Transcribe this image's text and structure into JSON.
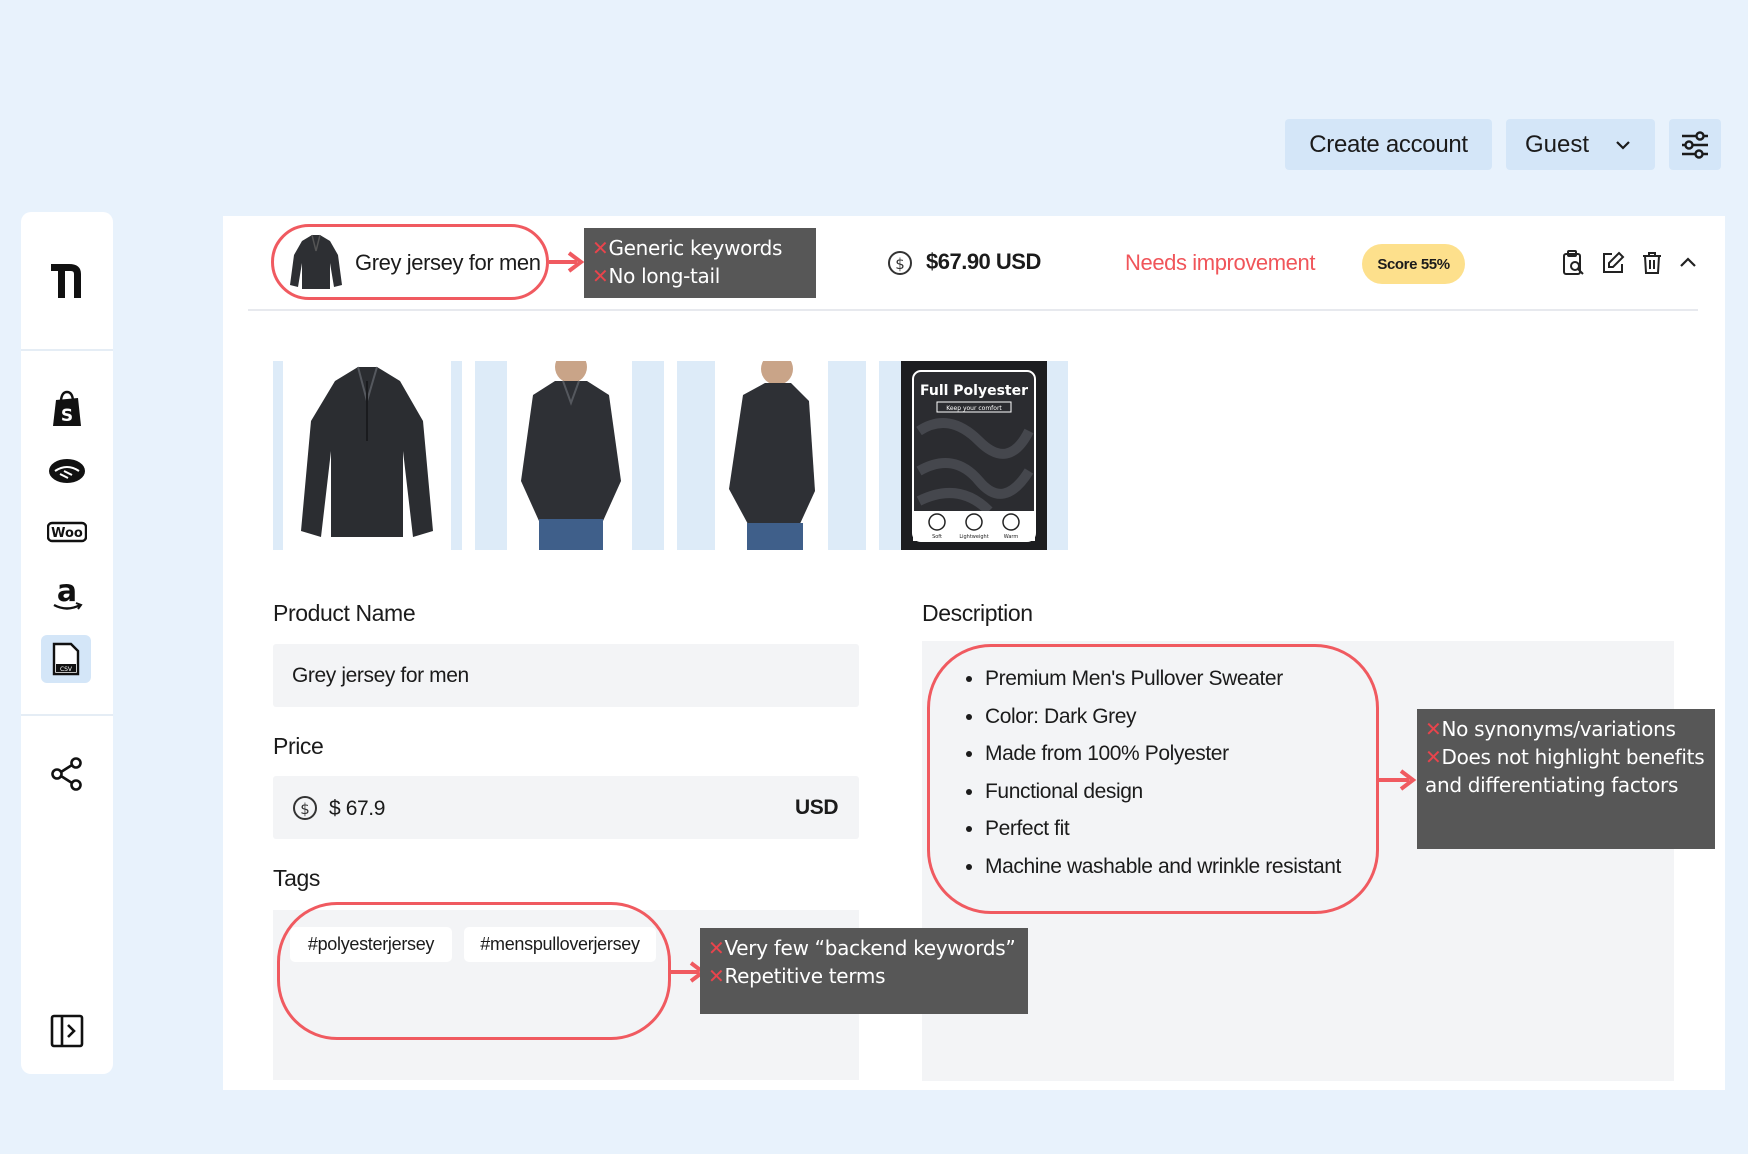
{
  "topbar": {
    "create_account": "Create account",
    "guest": "Guest"
  },
  "sidebar": {
    "logo": "logo-icon",
    "items": [
      "shopify-icon",
      "handshake-icon",
      "woo-icon",
      "amazon-icon",
      "csv-file-icon"
    ],
    "woo_text": "Woo",
    "csv_text": "CSV",
    "share": "share-icon",
    "collapse": "sidebar-toggle-icon"
  },
  "product": {
    "title": "Grey jersey for men",
    "price": "$67.90 USD",
    "status": "Needs improvement",
    "score": "Score 55%",
    "status_color": "#f0555a",
    "score_color": "#fde08c",
    "image_caption_title": "Full Polyester",
    "image_caption_sub": "Keep your comfort",
    "image_caption_icons": [
      "Soft",
      "Lightweight",
      "Warm"
    ]
  },
  "form": {
    "name_label": "Product Name",
    "name_value": "Grey jersey for men",
    "price_label": "Price",
    "price_value": "$ 67.9",
    "currency": "USD",
    "tags_label": "Tags",
    "tags": [
      "#polyesterjersey",
      "#menspulloverjersey"
    ],
    "description_label": "Description",
    "description_items": [
      "Premium Men's Pullover Sweater",
      "Color: Dark Grey",
      "Made from 100% Polyester",
      "Functional design",
      "Perfect fit",
      "Machine washable and wrinkle resistant"
    ]
  },
  "annotations": {
    "title_notes": [
      "Generic keywords",
      "No long-tail"
    ],
    "desc_notes": [
      "No synonyms/variations",
      "Does not highlight benefits and differentiating factors"
    ],
    "tag_notes": [
      "Very few “backend keywords”",
      "Repetitive terms"
    ],
    "mark": "✕",
    "accent": "#f05a60"
  }
}
